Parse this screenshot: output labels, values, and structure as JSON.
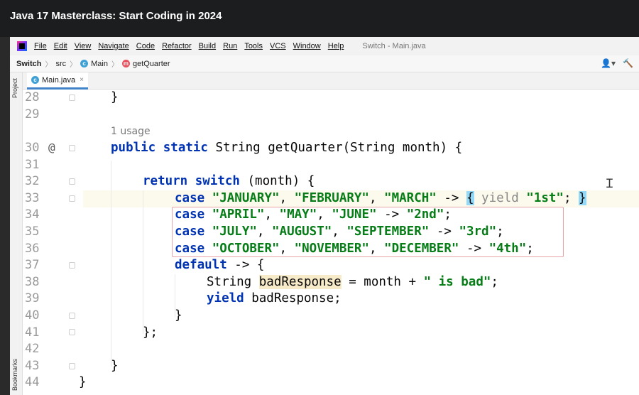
{
  "course": {
    "title": "Java 17 Masterclass: Start Coding in 2024"
  },
  "menu": {
    "items": [
      "File",
      "Edit",
      "View",
      "Navigate",
      "Code",
      "Refactor",
      "Build",
      "Run",
      "Tools",
      "VCS",
      "Window",
      "Help"
    ],
    "window_title": "Switch - Main.java"
  },
  "breadcrumb": {
    "project": "Switch",
    "folder": "src",
    "class": "Main",
    "method": "getQuarter"
  },
  "tool_windows": {
    "project": "Project",
    "bookmarks": "Bookmarks"
  },
  "tab": {
    "label": "Main.java"
  },
  "icons": {
    "class": "c",
    "method": "m",
    "close": "×",
    "user": "👤▾",
    "build": "🔨",
    "override": "@"
  },
  "editor": {
    "usage_hint": "1 usage",
    "line_numbers": [
      "28",
      "29",
      "30",
      "31",
      "32",
      "33",
      "34",
      "35",
      "36",
      "37",
      "38",
      "39",
      "40",
      "41",
      "42",
      "43",
      "44"
    ],
    "lines": {
      "l28": "}",
      "l30_a": "public static",
      "l30_b": " String getQuarter(String month) {",
      "l32_a": "return switch",
      "l32_b": " (month) {",
      "l33_kw": "case",
      "l33_s1": "\"JANUARY\"",
      "l33_c1": ", ",
      "l33_s2": "\"FEBRUARY\"",
      "l33_c2": ", ",
      "l33_s3": "\"MARCH\"",
      "l33_arrow": " -> ",
      "l33_ob": "{",
      "l33_yield": " yield ",
      "l33_s4": "\"1st\"",
      "l33_semi": "; ",
      "l33_cb": "}",
      "l34_kw": "case",
      "l34_s1": "\"APRIL\"",
      "l34_c1": ", ",
      "l34_s2": "\"MAY\"",
      "l34_c2": ", ",
      "l34_s3": "\"JUNE\"",
      "l34_arrow": " -> ",
      "l34_s4": "\"2nd\"",
      "l34_semi": ";",
      "l35_kw": "case",
      "l35_s1": "\"JULY\"",
      "l35_c1": ", ",
      "l35_s2": "\"AUGUST\"",
      "l35_c2": ", ",
      "l35_s3": "\"SEPTEMBER\"",
      "l35_arrow": " -> ",
      "l35_s4": "\"3rd\"",
      "l35_semi": ";",
      "l36_kw": "case",
      "l36_s1": "\"OCTOBER\"",
      "l36_c1": ", ",
      "l36_s2": "\"NOVEMBER\"",
      "l36_c2": ", ",
      "l36_s3": "\"DECEMBER\"",
      "l36_arrow": " -> ",
      "l36_s4": "\"4th\"",
      "l36_semi": ";",
      "l37_kw": "default",
      "l37_rest": " -> {",
      "l38_a": "String ",
      "l38_var": "badResponse",
      "l38_b": " = month + ",
      "l38_s": "\" is bad\"",
      "l38_c": ";",
      "l39_kw": "yield",
      "l39_rest": " badResponse;",
      "l40": "}",
      "l41": "};",
      "l43": "}",
      "l44": "}"
    }
  },
  "colors": {
    "keyword": "#0033b3",
    "string": "#067d17",
    "current_line": "#fcfaed",
    "selection_border": "#e8a4a9",
    "brace_match": "#93d9f7"
  }
}
